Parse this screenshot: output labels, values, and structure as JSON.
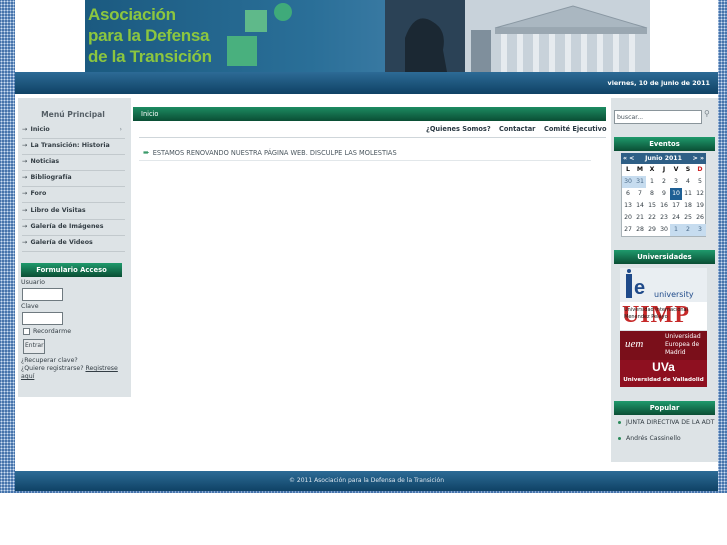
{
  "header": {
    "logo_lines": [
      "Asociación",
      "para la Defensa",
      "de la Transición"
    ],
    "date": "viernes, 10 de junio de 2011"
  },
  "left": {
    "menu_title": "Menú Principal",
    "menu_items": [
      {
        "label": "Inicio"
      },
      {
        "label": "La Transición: Historia"
      },
      {
        "label": "Noticias"
      },
      {
        "label": "Bibliografía"
      },
      {
        "label": "Foro"
      },
      {
        "label": "Libro de Visitas"
      },
      {
        "label": "Galería de Imágenes"
      },
      {
        "label": "Galería de Videos"
      }
    ],
    "login": {
      "title": "Formulario Acceso",
      "user_label": "Usuario",
      "pass_label": "Clave",
      "remember_label": "Recordarme",
      "submit_label": "Entrar",
      "forgot_label": "¿Recuperar clave?",
      "register_prefix": "¿Quiere registrarse? ",
      "register_link": "Registrese aquí"
    }
  },
  "main": {
    "breadcrumb": "Inicio",
    "nav": [
      "¿Quienes Somos?",
      "Contactar",
      "Comité Ejecutivo"
    ],
    "notice_arrow": "➨",
    "notice": "ESTAMOS RENOVANDO NUESTRA PÁGINA WEB. DISCULPE LAS MOLESTIAS"
  },
  "right": {
    "search_placeholder": "buscar...",
    "events_title": "Eventos",
    "calendar": {
      "prev": "« <",
      "month": "Junio 2011",
      "next": "> »",
      "weekdays": [
        "L",
        "M",
        "X",
        "J",
        "V",
        "S",
        "D"
      ],
      "days": [
        "30",
        "31",
        "1",
        "2",
        "3",
        "4",
        "5",
        "6",
        "7",
        "8",
        "9",
        "10",
        "11",
        "12",
        "13",
        "14",
        "15",
        "16",
        "17",
        "18",
        "19",
        "20",
        "21",
        "22",
        "23",
        "24",
        "25",
        "26",
        "27",
        "28",
        "29",
        "30",
        "1",
        "2",
        "3"
      ],
      "other_month_indices": [
        0,
        1,
        32,
        33,
        34
      ],
      "today_index": 11
    },
    "universities_title": "Universidades",
    "universities": [
      {
        "name": "ie university",
        "mark": "ie",
        "label": "university"
      },
      {
        "name": "Universidad Internacional Menéndez Pelayo",
        "mark": "UIMP",
        "label": "Universidad Internacional Menéndez Pelayo"
      },
      {
        "name": "Universidad Europea de Madrid",
        "mark": "uem",
        "label": "Universidad Europea de Madrid"
      },
      {
        "name": "Universidad de Valladolid",
        "mark": "UVa",
        "label": "Universidad de Valladolid"
      }
    ],
    "popular_title": "Popular",
    "popular_items": [
      "JUNTA DIRECTIVA DE LA ADT",
      "Andrés Cassinello"
    ]
  },
  "footer": {
    "text": "© 2011 Asociación para la Defensa de la Transición"
  },
  "colors": {
    "blue_band": "#0f4265",
    "green_bar": "#0a4e34",
    "logo_green": "#8cc63f",
    "sidebar_bg": "#dde3e6",
    "calendar_today": "#1e5f94"
  }
}
